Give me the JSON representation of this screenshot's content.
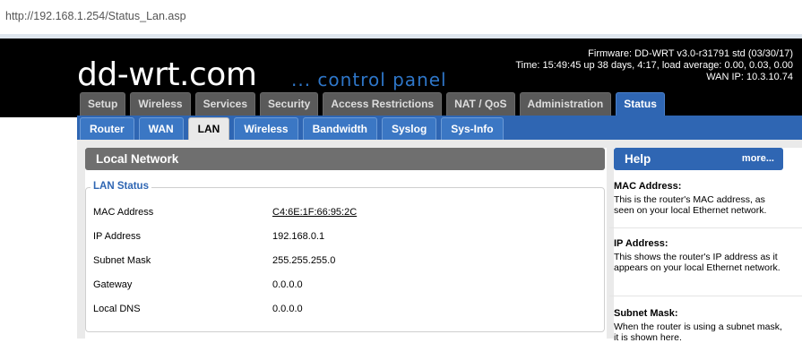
{
  "browser": {
    "url": "http://192.168.1.254/Status_Lan.asp"
  },
  "header": {
    "logo": "dd-wrt.com",
    "tagline": "... control panel",
    "firmware": "Firmware: DD-WRT v3.0-r31791 std (03/30/17)",
    "time": "Time: 15:49:45 up 38 days, 4:17, load average: 0.00, 0.03, 0.00",
    "wan_ip": "WAN IP: 10.3.10.74"
  },
  "main_tabs": [
    "Setup",
    "Wireless",
    "Services",
    "Security",
    "Access Restrictions",
    "NAT / QoS",
    "Administration",
    "Status"
  ],
  "sub_tabs": [
    "Router",
    "WAN",
    "LAN",
    "Wireless",
    "Bandwidth",
    "Syslog",
    "Sys-Info"
  ],
  "main": {
    "section_title": "Local Network",
    "fieldset_legend": "LAN Status",
    "rows": [
      {
        "label": "MAC Address",
        "value": "C4:6E:1F:66:95:2C"
      },
      {
        "label": "IP Address",
        "value": "192.168.0.1"
      },
      {
        "label": "Subnet Mask",
        "value": "255.255.255.0"
      },
      {
        "label": "Gateway",
        "value": "0.0.0.0"
      },
      {
        "label": "Local DNS",
        "value": "0.0.0.0"
      }
    ]
  },
  "help": {
    "title": "Help",
    "more": "more...",
    "entries": [
      {
        "heading": "MAC Address:",
        "text": "This is the router's MAC address, as seen on your local Ethernet network."
      },
      {
        "heading": "IP Address:",
        "text": "This shows the router's IP address as it appears on your local Ethernet network."
      },
      {
        "heading": "Subnet Mask:",
        "text": "When the router is using a subnet mask, it is shown here."
      }
    ]
  },
  "colors": {
    "accent": "#2f66b3",
    "tab_gray": "#5a5a5a",
    "header_bg": "#000000"
  }
}
